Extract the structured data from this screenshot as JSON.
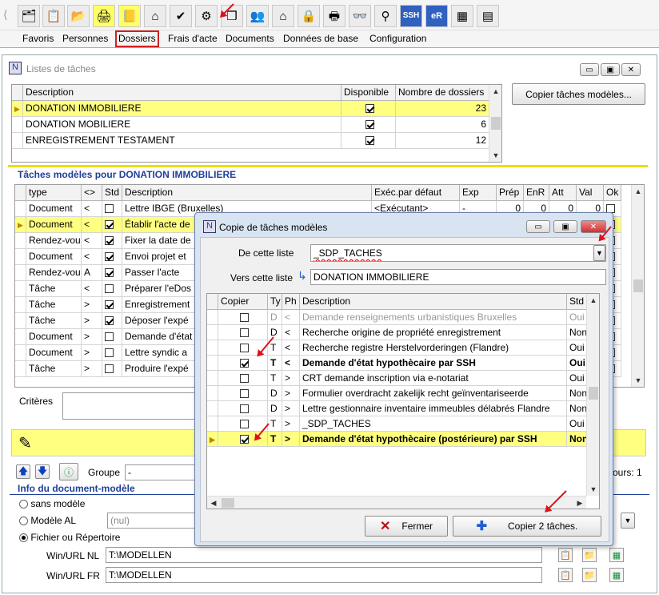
{
  "toolbar": {
    "icons": [
      "hierarchy-icon",
      "document-list-icon",
      "folder-open-icon",
      "printer-document-icon",
      "agenda-icon",
      "home-icon",
      "check-pen-icon",
      "tree-network-icon",
      "copy-pages-icon",
      "hierarchy-users-icon",
      "house-red-icon",
      "folder-lock-icon",
      "printer-lock-icon",
      "glasses-icon",
      "stamp-icon",
      "ssh-icon",
      "er-icon",
      "table-icon"
    ],
    "ssh_label": "SSH",
    "er_label": "eR"
  },
  "tabs": [
    "Favoris",
    "Personnes",
    "Dossiers",
    "Frais d'acte",
    "Documents",
    "Données de base",
    "Configuration"
  ],
  "tasklist_window": {
    "title": "Listes de tâches",
    "copy_button": "Copier tâches modèles...",
    "headers": [
      "Description",
      "Disponible",
      "Nombre de dossiers"
    ],
    "rows": [
      {
        "description": "DONATION IMMOBILIERE",
        "available": true,
        "count": "23"
      },
      {
        "description": "DONATION MOBILIERE",
        "available": true,
        "count": "6"
      },
      {
        "description": "ENREGISTREMENT TESTAMENT",
        "available": true,
        "count": "12"
      }
    ]
  },
  "model_tasks": {
    "title": "Tâches modèles pour DONATION IMMOBILIERE",
    "headers": [
      "type",
      "<>",
      "Std",
      "Description",
      "Exéc.par défaut",
      "Exp",
      "Prép",
      "EnR",
      "Att",
      "Val",
      "Ok"
    ],
    "rows": [
      {
        "type": "Document",
        "dir": "<",
        "std": false,
        "desc": "Lettre IBGE (Bruxelles)",
        "exec": "<Exécutant>",
        "exp": "-",
        "prep": "0",
        "enr": "0",
        "att": "0",
        "val": "0"
      },
      {
        "type": "Document",
        "dir": "<",
        "std": true,
        "desc": "Établir l'acte de"
      },
      {
        "type": "Rendez-vou",
        "dir": "<",
        "std": true,
        "desc": "Fixer la date de"
      },
      {
        "type": "Document",
        "dir": "<",
        "std": true,
        "desc": "Envoi projet et"
      },
      {
        "type": "Rendez-vou",
        "dir": "A",
        "std": true,
        "desc": "Passer l'acte"
      },
      {
        "type": "Tâche",
        "dir": "<",
        "std": false,
        "desc": "Préparer l'eDos"
      },
      {
        "type": "Tâche",
        "dir": ">",
        "std": true,
        "desc": "Enregistrement"
      },
      {
        "type": "Tâche",
        "dir": ">",
        "std": true,
        "desc": "Déposer l'expé"
      },
      {
        "type": "Document",
        "dir": ">",
        "std": false,
        "desc": "Demande d'état"
      },
      {
        "type": "Document",
        "dir": ">",
        "std": false,
        "desc": "Lettre syndic a"
      },
      {
        "type": "Tâche",
        "dir": ">",
        "std": false,
        "desc": "Produire l'expé"
      }
    ]
  },
  "criteria_label": "Critères",
  "groupe_label": "Groupe",
  "groupe_value": "-",
  "jours_label": "ours: 1",
  "doc_model": {
    "title": "Info du document-modèle",
    "options": [
      "sans modèle",
      "Modèle AL",
      "Fichier ou Répertoire"
    ],
    "model_al_value": "(nul)",
    "win_nl_label": "Win/URL NL",
    "win_nl_value": "T:\\MODELLEN",
    "win_fr_label": "Win/URL FR",
    "win_fr_value": "T:\\MODELLEN"
  },
  "dialog": {
    "title": "Copie de tâches modèles",
    "from_label": "De cette liste",
    "from_value": "_SDP_TACHES",
    "to_label": "Vers cette liste",
    "to_value": "DONATION IMMOBILIERE",
    "headers": [
      "Copier",
      "Ty",
      "Ph",
      "Description",
      "Std"
    ],
    "rows": [
      {
        "copy": false,
        "ty": "D",
        "ph": "<",
        "desc": "Demande renseignements urbanistiques Bruxelles",
        "std": "Oui",
        "grey": true
      },
      {
        "copy": false,
        "ty": "D",
        "ph": "<",
        "desc": "Recherche origine de propriété enregistrement",
        "std": "Non"
      },
      {
        "copy": false,
        "ty": "T",
        "ph": "<",
        "desc": "Recherche registre Herstelvorderingen (Flandre)",
        "std": "Oui"
      },
      {
        "copy": true,
        "ty": "T",
        "ph": "<",
        "desc": "Demande d'état hypothècaire par SSH",
        "std": "Oui",
        "bold": true
      },
      {
        "copy": false,
        "ty": "T",
        "ph": ">",
        "desc": "CRT demande inscription via e-notariat",
        "std": "Oui"
      },
      {
        "copy": false,
        "ty": "D",
        "ph": ">",
        "desc": "Formulier overdracht zakelijk recht geïnventariseerde",
        "std": "Non"
      },
      {
        "copy": false,
        "ty": "D",
        "ph": ">",
        "desc": "Lettre gestionnaire inventaire immeubles délabrés Flandre",
        "std": "Non"
      },
      {
        "copy": false,
        "ty": "T",
        "ph": ">",
        "desc": "_SDP_TACHES",
        "std": "Oui"
      },
      {
        "copy": true,
        "ty": "T",
        "ph": ">",
        "desc": "Demande d'état hypothècaire (postérieure) par SSH",
        "std": "Non",
        "bold": true,
        "selected": true
      }
    ],
    "close_button": "Fermer",
    "copy_button": "Copier 2 tâches."
  },
  "colors": {
    "selected_row": "#ffff80",
    "accent_red": "#e0101a",
    "title_blue": "#1f3f99"
  }
}
